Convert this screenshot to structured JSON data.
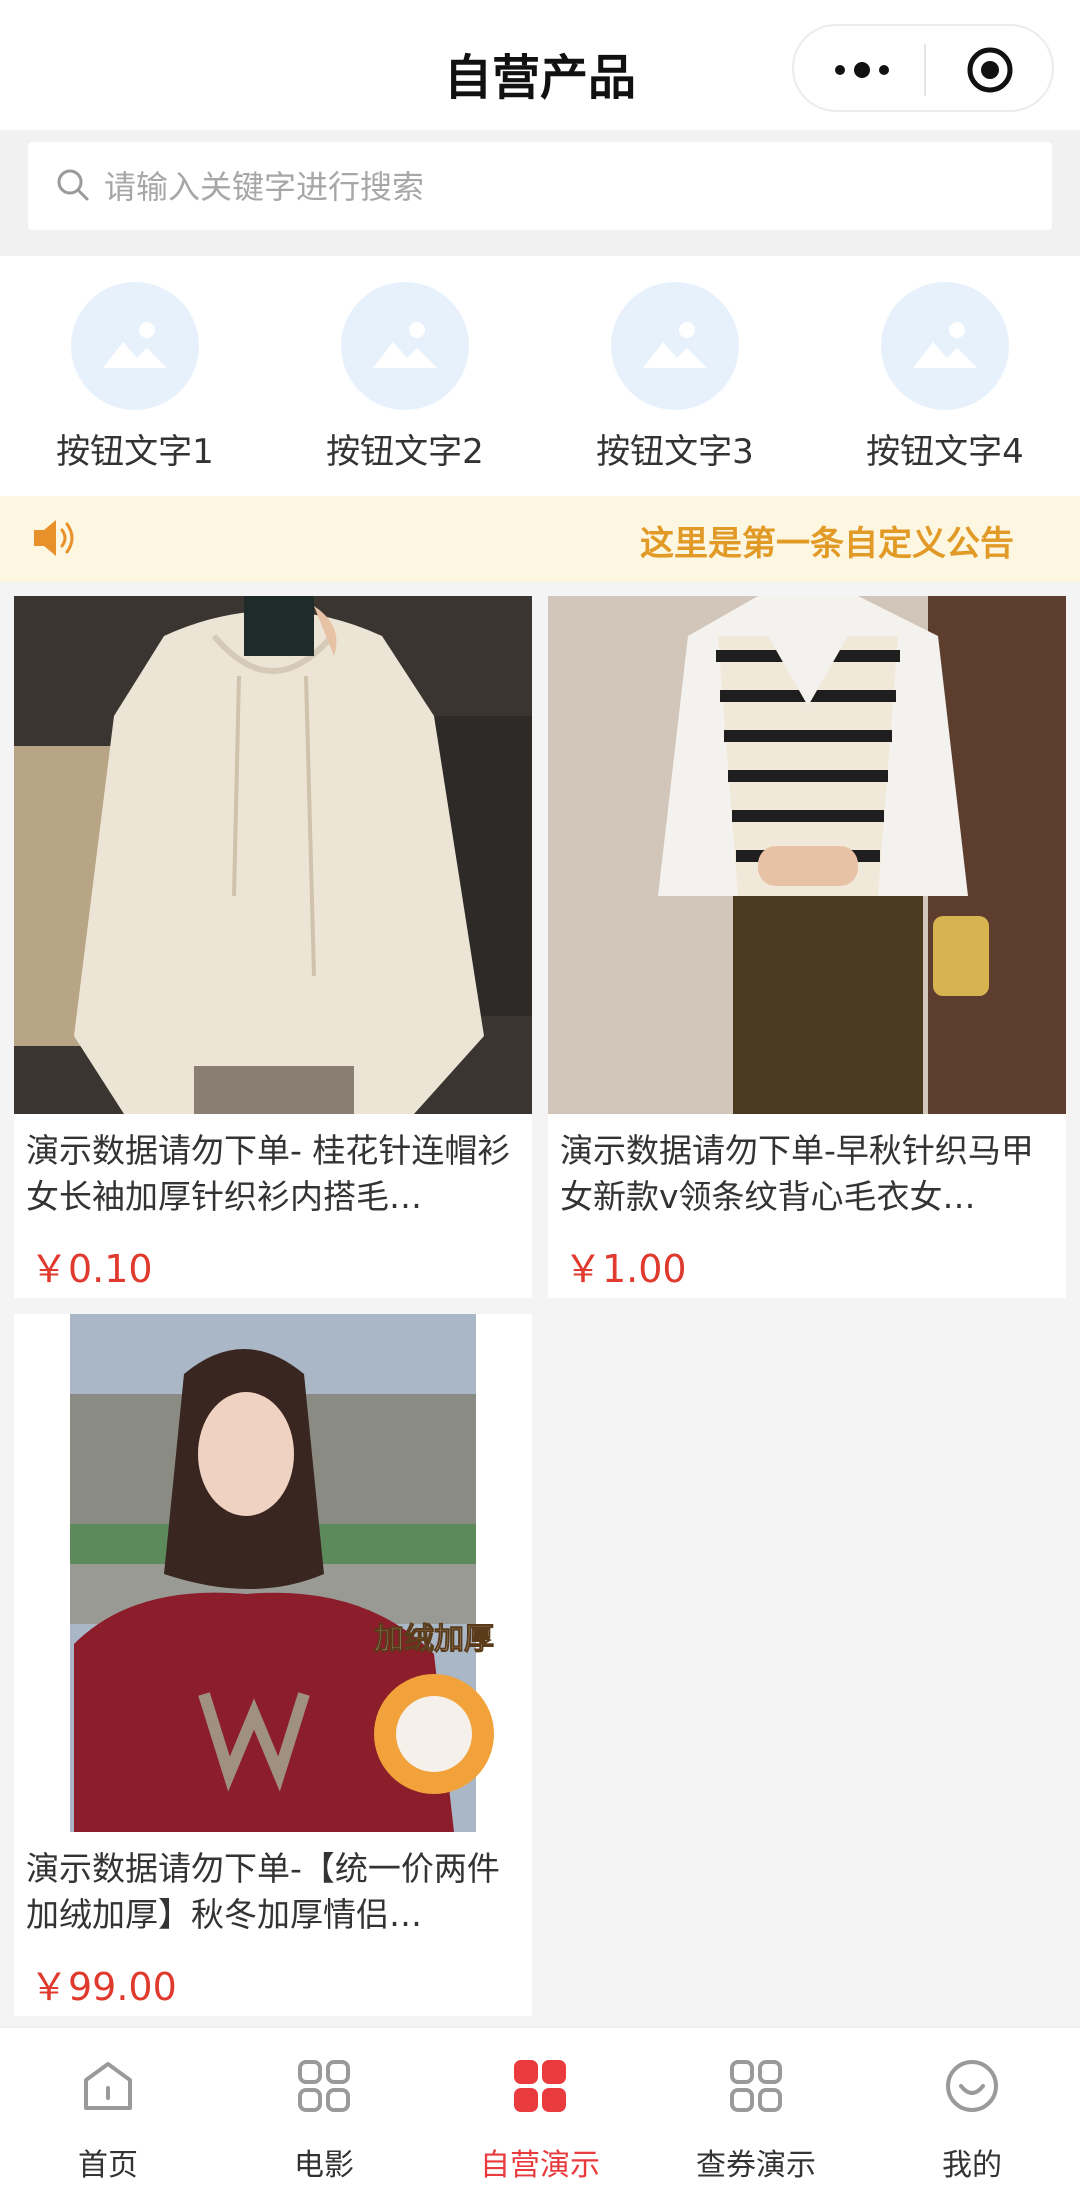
{
  "header": {
    "title": "自营产品"
  },
  "search": {
    "placeholder": "请输入关键字进行搜索"
  },
  "nav_buttons": [
    {
      "label": "按钮文字1",
      "icon": "image-placeholder-icon"
    },
    {
      "label": "按钮文字2",
      "icon": "image-placeholder-icon"
    },
    {
      "label": "按钮文字3",
      "icon": "image-placeholder-icon"
    },
    {
      "label": "按钮文字4",
      "icon": "image-placeholder-icon"
    }
  ],
  "notice": {
    "text": "这里是第一条自定义公告",
    "icon": "speaker-icon"
  },
  "products": [
    {
      "title": "演示数据请勿下单- 桂花针连帽衫女长袖加厚针织衫内搭毛…",
      "price": "￥0.10"
    },
    {
      "title": "演示数据请勿下单-早秋针织马甲女新款v领条纹背心毛衣女…",
      "price": "￥1.00"
    },
    {
      "title": "演示数据请勿下单-【统一价两件加绒加厚】秋冬加厚情侣…",
      "price": "￥99.00",
      "badge": "加绒加厚"
    }
  ],
  "tabbar": [
    {
      "label": "首页",
      "icon": "home-icon",
      "active": false
    },
    {
      "label": "电影",
      "icon": "grid-icon",
      "active": false
    },
    {
      "label": "自营演示",
      "icon": "grid-icon",
      "active": true
    },
    {
      "label": "查券演示",
      "icon": "grid-icon",
      "active": false
    },
    {
      "label": "我的",
      "icon": "smile-icon",
      "active": false
    }
  ],
  "colors": {
    "accent": "#e93b3d",
    "price": "#e0392d",
    "notice": "#e29a27",
    "notice_bg": "#fdf6e1",
    "nav_circle": "#e7f1fc"
  }
}
